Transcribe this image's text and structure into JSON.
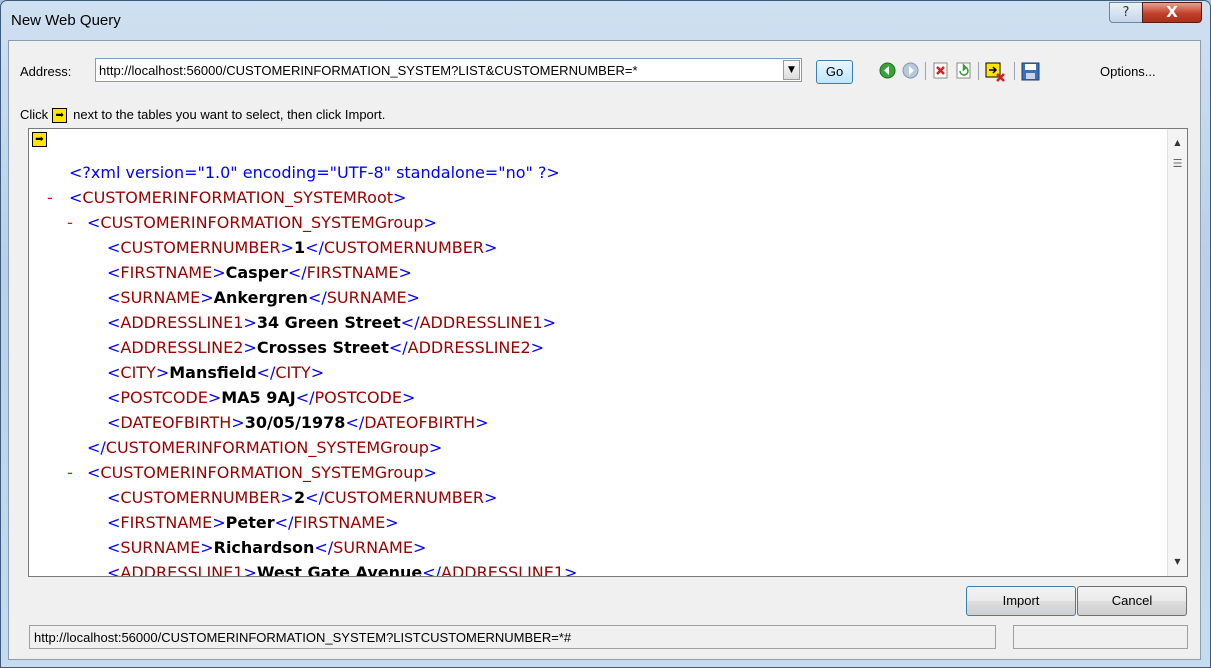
{
  "window": {
    "title": "New Web Query",
    "help_glyph": "?",
    "close_glyph": "X"
  },
  "toolbar": {
    "address_label": "Address:",
    "address_value": "http://localhost:56000/CUSTOMERINFORMATION_SYSTEM?LIST&CUSTOMERNUMBER=*",
    "dropdown_glyph": "▼",
    "go_label": "Go",
    "options_label": "Options..."
  },
  "instruction": {
    "before": "Click",
    "after": "next to the tables you want to select, then click Import."
  },
  "xml_lines": [
    {
      "indent": 0,
      "minus": false,
      "pi": "<?xml version=\"1.0\" encoding=\"UTF-8\" standalone=\"no\" ?>"
    },
    {
      "indent": 0,
      "minus": true,
      "open": "CUSTOMERINFORMATION_SYSTEMRoot"
    },
    {
      "indent": 1,
      "minus": true,
      "open": "CUSTOMERINFORMATION_SYSTEMGroup"
    },
    {
      "indent": 2,
      "tag": "CUSTOMERNUMBER",
      "value": "1"
    },
    {
      "indent": 2,
      "tag": "FIRSTNAME",
      "value": "Casper"
    },
    {
      "indent": 2,
      "tag": "SURNAME",
      "value": "Ankergren"
    },
    {
      "indent": 2,
      "tag": "ADDRESSLINE1",
      "value": "34 Green Street"
    },
    {
      "indent": 2,
      "tag": "ADDRESSLINE2",
      "value": "Crosses Street"
    },
    {
      "indent": 2,
      "tag": "CITY",
      "value": "Mansfield"
    },
    {
      "indent": 2,
      "tag": "POSTCODE",
      "value": "MA5 9AJ"
    },
    {
      "indent": 2,
      "tag": "DATEOFBIRTH",
      "value": "30/05/1978"
    },
    {
      "indent": 1,
      "close": "CUSTOMERINFORMATION_SYSTEMGroup"
    },
    {
      "indent": 1,
      "minus": true,
      "open": "CUSTOMERINFORMATION_SYSTEMGroup"
    },
    {
      "indent": 2,
      "tag": "CUSTOMERNUMBER",
      "value": "2"
    },
    {
      "indent": 2,
      "tag": "FIRSTNAME",
      "value": "Peter"
    },
    {
      "indent": 2,
      "tag": "SURNAME",
      "value": "Richardson"
    },
    {
      "indent": 2,
      "tag": "ADDRESSLINE1",
      "value": "West Gate Avenue"
    }
  ],
  "buttons": {
    "import_label": "Import",
    "cancel_label": "Cancel"
  },
  "status": {
    "url": "http://localhost:56000/CUSTOMERINFORMATION_SYSTEM?LISTCUSTOMERNUMBER=*#"
  },
  "icons": {
    "select_arrow": "➡",
    "back": "back-arrow-icon",
    "forward": "forward-arrow-icon",
    "stop": "stop-icon",
    "refresh": "refresh-icon",
    "hide_icons": "hide-icons-icon",
    "save_query": "save-query-icon"
  },
  "colors": {
    "xml_tag": "#990000",
    "xml_blue": "#0000ff",
    "minus": "#ff0000",
    "select_arrow_bg": "#ffe600"
  }
}
